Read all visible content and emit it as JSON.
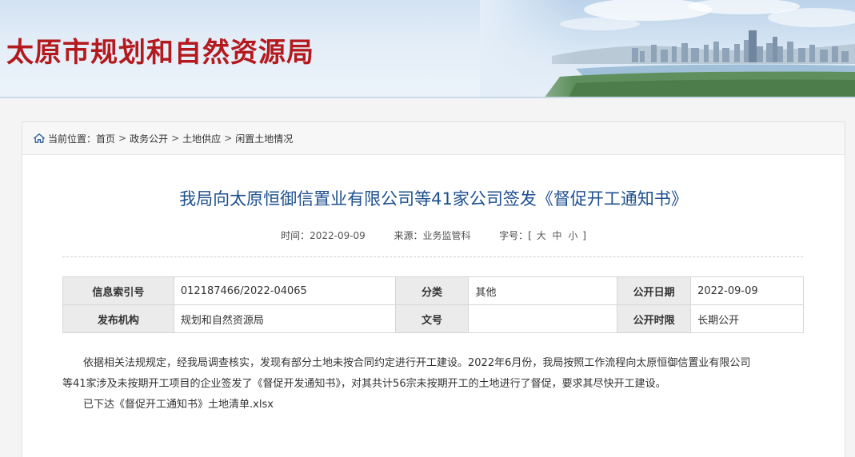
{
  "header": {
    "site_title": "太原市规划和自然资源局"
  },
  "breadcrumb": {
    "prefix": "当前位置：",
    "items": [
      "首页",
      "政务公开",
      "土地供应",
      "闲置土地情况"
    ],
    "separator": ">"
  },
  "article": {
    "title": "我局向太原恒御信置业有限公司等41家公司签发《督促开工通知书》",
    "meta": {
      "time_label": "时间：",
      "time_value": "2022-09-09",
      "source_label": "来源：",
      "source_value": "业务监管科",
      "fontsize_label": "字号：",
      "bracket_open": "[",
      "bracket_close": "]",
      "size_large": "大",
      "size_medium": "中",
      "size_small": "小"
    },
    "info": {
      "index_label": "信息索引号",
      "index_value": "012187466/2022-04065",
      "category_label": "分类",
      "category_value": "其他",
      "pubdate_label": "公开日期",
      "pubdate_value": "2022-09-09",
      "org_label": "发布机构",
      "org_value": "规划和自然资源局",
      "docno_label": "文号",
      "docno_value": "",
      "period_label": "公开时限",
      "period_value": "长期公开"
    },
    "paragraph_1_line_1": "依据相关法规规定，经我局调查核实，发现有部分土地未按合同约定进行开工建设。2022年6月份，我局按照工作流程向太原恒御信置业有限公司",
    "paragraph_1_line_2": "等41家涉及未按期开工项目的企业签发了《督促开发通知书》，对其共计56宗未按期开工的土地进行了督促，要求其尽快开工建设。",
    "paragraph_2_prefix": "已下达",
    "attachment_name": "《督促开工通知书》土地清单.xlsx"
  }
}
